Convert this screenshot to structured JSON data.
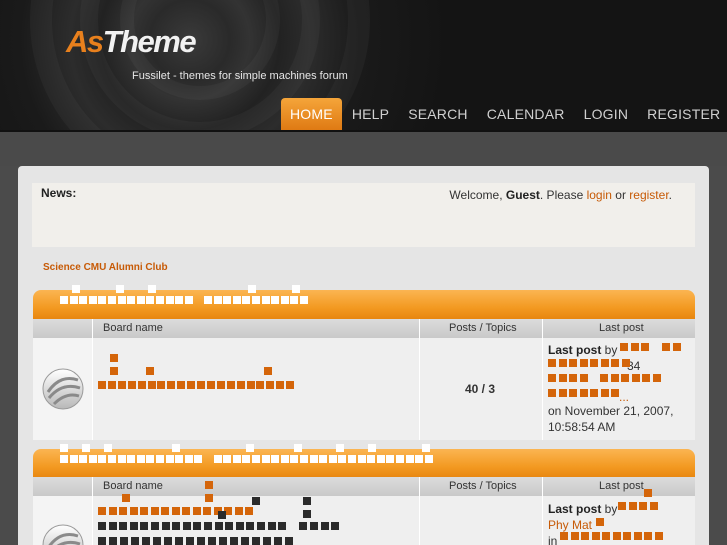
{
  "header": {
    "logo_as": "As",
    "logo_theme": "Theme",
    "tagline": "Fussilet - themes for simple machines forum"
  },
  "nav": [
    {
      "label": "HOME",
      "active": true
    },
    {
      "label": "HELP"
    },
    {
      "label": "SEARCH"
    },
    {
      "label": "CALENDAR"
    },
    {
      "label": "LOGIN"
    },
    {
      "label": "REGISTER"
    }
  ],
  "news": {
    "label": "News",
    "welcome_prefix": "Welcome, ",
    "user": "Guest",
    "please": ". Please ",
    "login": "login",
    "or": " or ",
    "register": "register",
    "period": "."
  },
  "category_link": "Science CMU Alumni Club",
  "table_headers": {
    "board": "Board name",
    "stats": "Posts / Topics",
    "last": "Last post"
  },
  "boards": [
    {
      "stats": "40 / 3",
      "last_post_label": "Last post",
      "by": " by",
      "mid_text": "34",
      "ellipsis": "...",
      "date": "on November 21, 2007,",
      "time": "10:58:54 AM"
    },
    {
      "stats": "",
      "last_post_label": "Last post",
      "by": " by",
      "author": "Phy Mat",
      "in": "in"
    }
  ],
  "colors": {
    "accent": "#e8801d",
    "link": "#c75a06",
    "header_bg": "#1a1a1a",
    "container_bg": "#e5e5e5"
  }
}
